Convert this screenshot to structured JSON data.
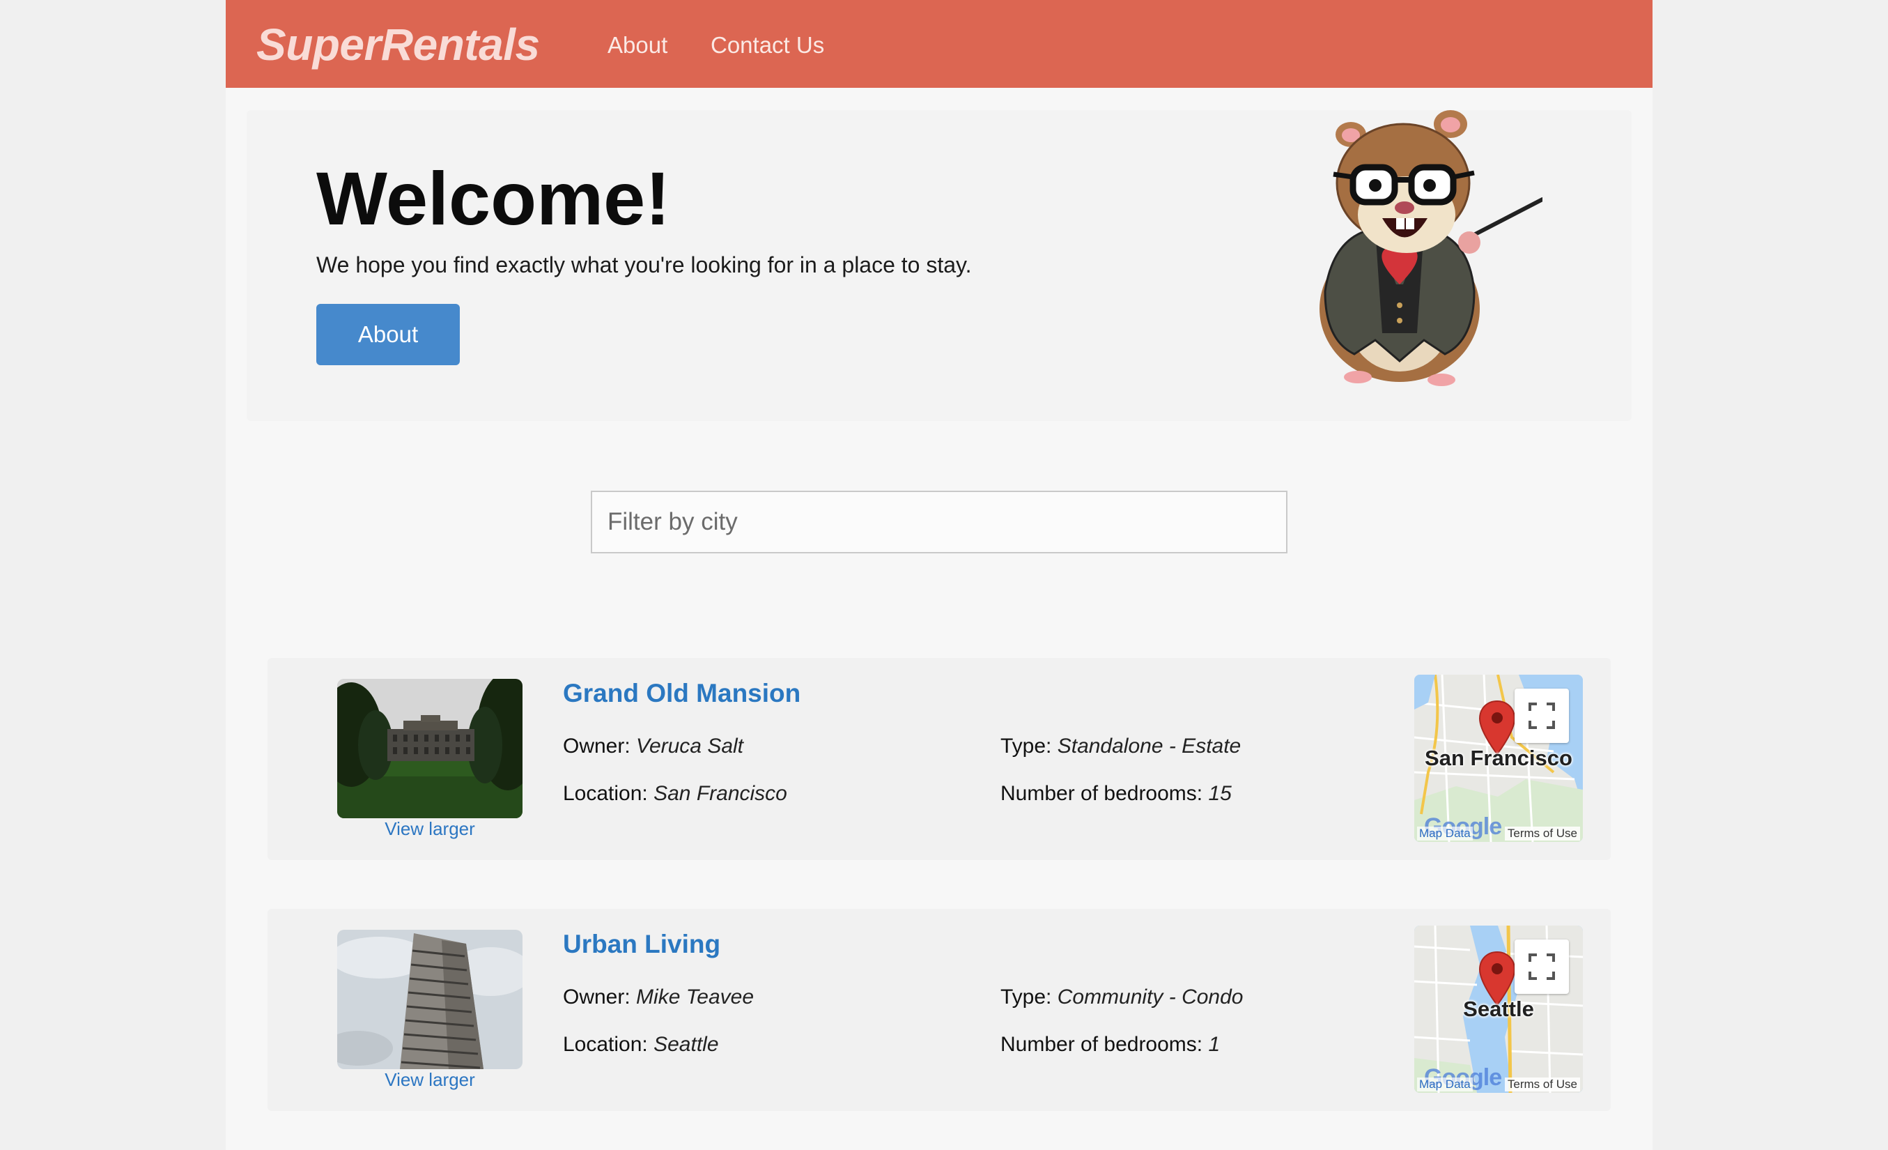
{
  "header": {
    "brand": "SuperRentals",
    "nav": {
      "about": "About",
      "contact": "Contact Us"
    },
    "color": "#dc6652"
  },
  "jumbo": {
    "title": "Welcome!",
    "subtitle": "We hope you find exactly what you're looking for in a place to stay.",
    "button": "About",
    "button_color": "#4689cc"
  },
  "filter": {
    "placeholder": "Filter by city",
    "value": ""
  },
  "rentals": [
    {
      "title": "Grand Old Mansion",
      "owner_label": "Owner:",
      "owner": "Veruca Salt",
      "location_label": "Location:",
      "location": "San Francisco",
      "type_label": "Type:",
      "type": "Standalone - Estate",
      "bedrooms_label": "Number of bedrooms:",
      "bedrooms": "15",
      "view_larger": "View larger",
      "map": {
        "city": "San Francisco",
        "map_data": "Map Data",
        "terms": "Terms of Use",
        "logo": "Google"
      }
    },
    {
      "title": "Urban Living",
      "owner_label": "Owner:",
      "owner": "Mike Teavee",
      "location_label": "Location:",
      "location": "Seattle",
      "type_label": "Type:",
      "type": "Community - Condo",
      "bedrooms_label": "Number of bedrooms:",
      "bedrooms": "1",
      "view_larger": "View larger",
      "map": {
        "city": "Seattle",
        "map_data": "Map Data",
        "terms": "Terms of Use",
        "logo": "Google"
      }
    }
  ],
  "icons": {
    "fullscreen": "fullscreen-icon",
    "map_pin": "map-pin-icon",
    "mascot": "tomster-mascot"
  }
}
